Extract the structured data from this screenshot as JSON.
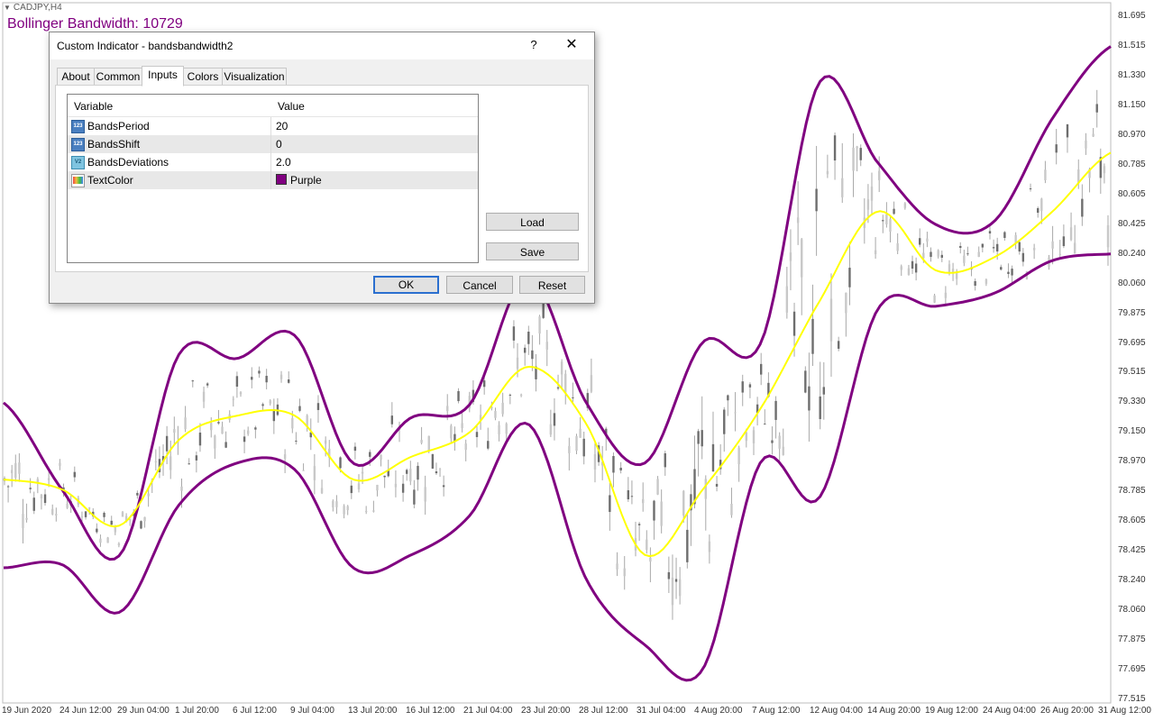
{
  "chart": {
    "symbol": "CADJPY,H4",
    "indicator_label": "Bollinger Bandwidth: 10729",
    "price_labels": [
      "81.695",
      "81.515",
      "81.330",
      "81.150",
      "80.970",
      "80.785",
      "80.605",
      "80.425",
      "80.240",
      "80.060",
      "79.875",
      "79.695",
      "79.515",
      "79.330",
      "79.150",
      "78.970",
      "78.785",
      "78.605",
      "78.425",
      "78.240",
      "78.060",
      "77.875",
      "77.695",
      "77.515"
    ],
    "time_labels": [
      "19 Jun 2020",
      "24 Jun 12:00",
      "29 Jun 04:00",
      "1 Jul 20:00",
      "6 Jul 12:00",
      "9 Jul 04:00",
      "13 Jul 20:00",
      "16 Jul 12:00",
      "21 Jul 04:00",
      "23 Jul 20:00",
      "28 Jul 12:00",
      "31 Jul 04:00",
      "4 Aug 20:00",
      "7 Aug 12:00",
      "12 Aug 04:00",
      "14 Aug 20:00",
      "19 Aug 12:00",
      "24 Aug 04:00",
      "26 Aug 20:00",
      "31 Aug 12:00"
    ],
    "colors": {
      "upper_band": "#800080",
      "lower_band": "#800080",
      "middle_band": "#ffff00",
      "candles": "#a0a0a0"
    }
  },
  "chart_data": {
    "type": "line",
    "title": "Bollinger Bandwidth: 10729",
    "xlabel": "",
    "ylabel": "",
    "ylim": [
      77.515,
      81.695
    ],
    "x": [
      "19 Jun 2020",
      "24 Jun 12:00",
      "29 Jun 04:00",
      "1 Jul 20:00",
      "6 Jul 12:00",
      "9 Jul 04:00",
      "13 Jul 20:00",
      "16 Jul 12:00",
      "21 Jul 04:00",
      "23 Jul 20:00",
      "28 Jul 12:00",
      "31 Jul 04:00",
      "4 Aug 20:00",
      "7 Aug 12:00",
      "12 Aug 04:00",
      "14 Aug 20:00",
      "19 Aug 12:00",
      "24 Aug 04:00",
      "26 Aug 20:00",
      "31 Aug 12:00"
    ],
    "series": [
      {
        "values": [
          79.33,
          78.8,
          78.4,
          79.62,
          79.6,
          79.74,
          78.96,
          79.24,
          79.32,
          80.1,
          79.33,
          78.96,
          79.7,
          79.7,
          81.29,
          80.8,
          80.42,
          80.44,
          81.07,
          81.51
        ]
      },
      {
        "values": [
          78.86,
          78.8,
          78.58,
          79.1,
          79.25,
          79.25,
          78.86,
          79.0,
          79.15,
          79.55,
          79.2,
          78.4,
          78.8,
          79.3,
          79.95,
          80.5,
          80.14,
          80.22,
          80.5,
          80.86
        ]
      },
      {
        "values": [
          78.32,
          78.34,
          78.05,
          78.7,
          78.96,
          78.92,
          78.32,
          78.4,
          78.64,
          79.2,
          78.25,
          77.85,
          77.7,
          78.97,
          78.75,
          79.9,
          79.92,
          80.0,
          80.2,
          80.24
        ]
      }
    ]
  },
  "dialog": {
    "title": "Custom Indicator - bandsbandwidth2",
    "help": "?",
    "close": "✕",
    "tabs": [
      "About",
      "Common",
      "Inputs",
      "Colors",
      "Visualization"
    ],
    "headers": {
      "variable": "Variable",
      "value": "Value"
    },
    "rows": [
      {
        "icon": "123",
        "variable": "BandsPeriod",
        "value": "20"
      },
      {
        "icon": "123",
        "variable": "BandsShift",
        "value": "0"
      },
      {
        "icon": "V2",
        "variable": "BandsDeviations",
        "value": "2.0"
      },
      {
        "icon": "",
        "variable": "TextColor",
        "value": "Purple",
        "swatch": "#800080"
      }
    ],
    "buttons": {
      "load": "Load",
      "save": "Save",
      "ok": "OK",
      "cancel": "Cancel",
      "reset": "Reset"
    }
  }
}
